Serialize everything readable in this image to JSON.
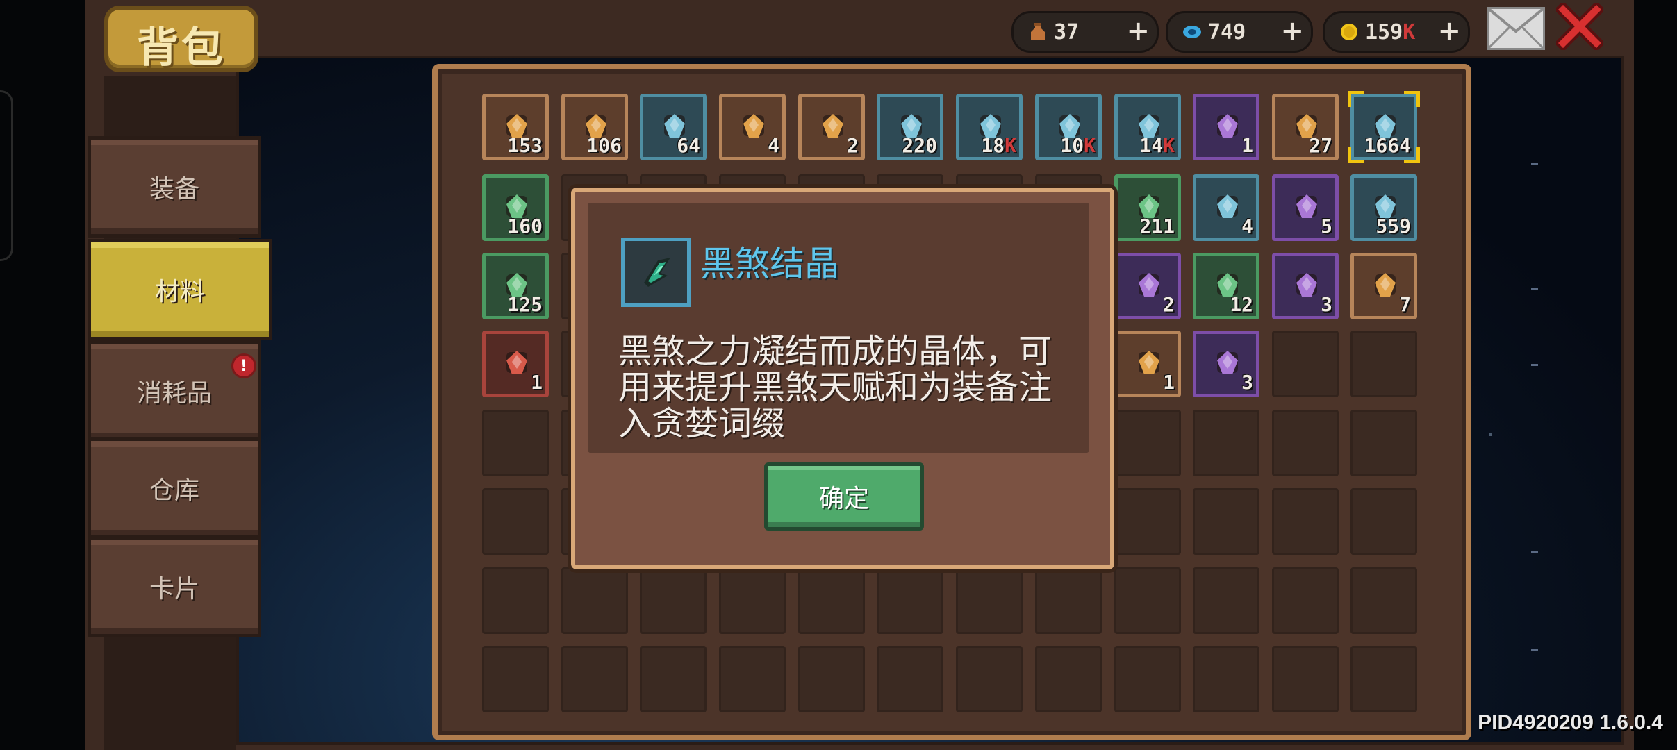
{
  "header": {
    "title": "背包"
  },
  "sidebar": {
    "tabs": [
      {
        "label": "装备"
      },
      {
        "label": "材料"
      },
      {
        "label": "消耗品",
        "badge": "!"
      },
      {
        "label": "仓库"
      },
      {
        "label": "卡片"
      }
    ]
  },
  "resources": [
    {
      "icon": "potion-bag-icon",
      "value": "37",
      "plus": "+"
    },
    {
      "icon": "blue-gem-icon",
      "value": "749",
      "plus": "+"
    },
    {
      "icon": "gold-coin-icon",
      "value": "159",
      "suffix": "K",
      "plus": "+"
    }
  ],
  "inventory": {
    "row1": [
      {
        "icon": "key-icon",
        "count": "153",
        "rarity": "orange"
      },
      {
        "icon": "ticket-icon",
        "count": "106",
        "rarity": "orange"
      },
      {
        "icon": "gold-ring-icon",
        "count": "64",
        "rarity": "blue"
      },
      {
        "icon": "stone-icon",
        "count": "4",
        "rarity": "orange"
      },
      {
        "icon": "scroll-icon",
        "count": "2",
        "rarity": "orange"
      },
      {
        "icon": "rainbow-shard-icon",
        "count": "220",
        "rarity": "blue"
      },
      {
        "icon": "purple-flame-icon",
        "count": "18",
        "suffix": "K",
        "rarity": "blue"
      },
      {
        "icon": "blue-flame-icon",
        "count": "10",
        "suffix": "K",
        "rarity": "blue"
      },
      {
        "icon": "yellow-flame-icon",
        "count": "14",
        "suffix": "K",
        "rarity": "blue"
      },
      {
        "icon": "green-orb-icon",
        "count": "1",
        "rarity": "purple"
      },
      {
        "icon": "spiral-icon",
        "count": "27",
        "rarity": "orange"
      },
      {
        "icon": "dark-crystal-icon",
        "count": "1664",
        "rarity": "blue",
        "selected": true
      }
    ],
    "row2": [
      {
        "icon": "dark-gem-icon",
        "count": "160",
        "rarity": "green"
      },
      {
        "icon": "green-leaf-icon",
        "count": "211",
        "rarity": "green"
      },
      {
        "icon": "blue-leaf-icon",
        "count": "4",
        "rarity": "blue"
      },
      {
        "icon": "purple-leaf-icon",
        "count": "5",
        "rarity": "purple"
      },
      {
        "icon": "pouch-icon",
        "count": "559",
        "rarity": "blue"
      }
    ],
    "row3": [
      {
        "icon": "map-icon",
        "count": "125",
        "rarity": "green"
      },
      {
        "icon": "feather-icon",
        "count": "2",
        "rarity": "purple"
      },
      {
        "icon": "green-map-icon",
        "count": "12",
        "rarity": "green"
      },
      {
        "icon": "purple-map-icon",
        "count": "3",
        "rarity": "purple"
      },
      {
        "icon": "rainbow-map-icon",
        "count": "7",
        "rarity": "orange"
      }
    ],
    "row4": [
      {
        "icon": "red-card-icon",
        "count": "1",
        "rarity": "red"
      },
      {
        "icon": "pyramid-icon",
        "count": "1",
        "rarity": "orange"
      },
      {
        "icon": "skull-bat-icon",
        "count": "3",
        "rarity": "purple"
      }
    ]
  },
  "dialog": {
    "item_icon": "dark-crystal-icon",
    "title": "黑煞结晶",
    "description_lines": [
      "黑煞之力凝结而成的晶体，可",
      "用来提升黑煞天赋和为装备注",
      "入贪婪词缀"
    ],
    "confirm_label": "确定"
  },
  "footer": {
    "version": "PID4920209 1.6.0.4"
  },
  "colors": {
    "accent_gold": "#c9b13a",
    "dialog_title": "#5fc6ec",
    "confirm_green": "#4faa6b",
    "badge_red": "#c0272d"
  }
}
